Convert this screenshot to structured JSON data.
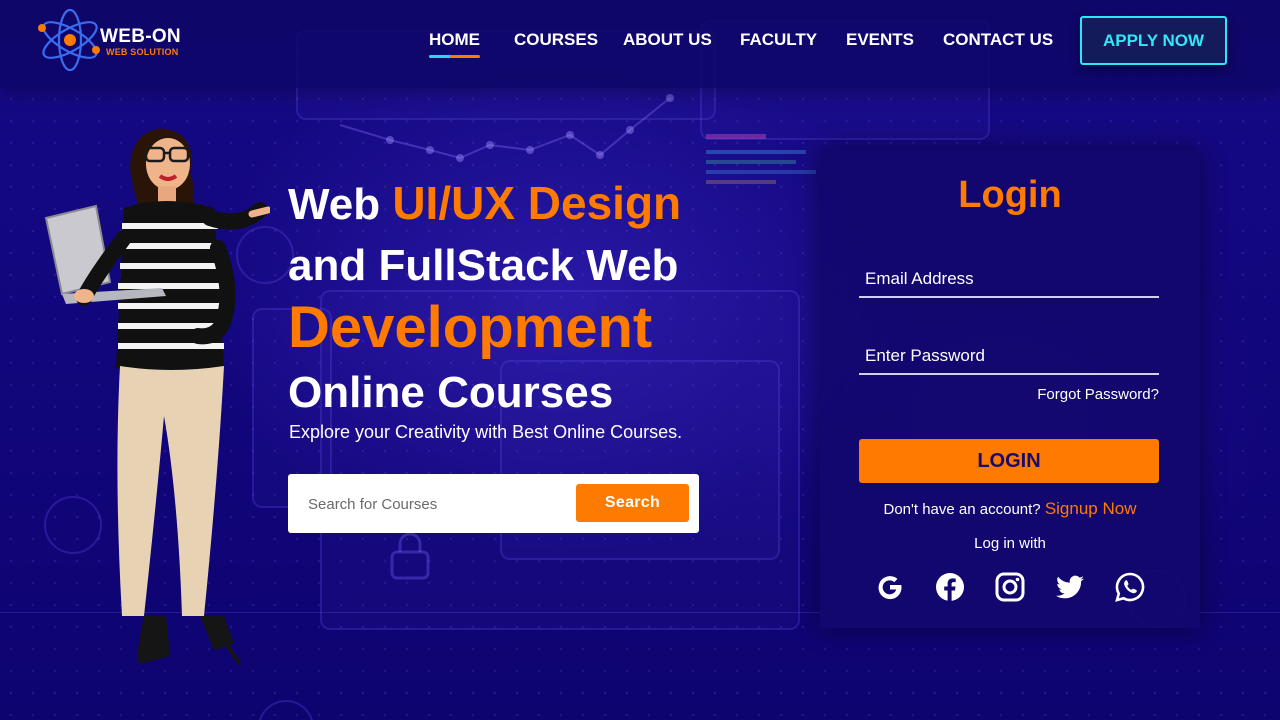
{
  "logo": {
    "name": "WEB-ON",
    "subtitle": "WEB SOLUTION",
    "icon": "atom-icon"
  },
  "nav": {
    "items": [
      {
        "label": "HOME",
        "active": true
      },
      {
        "label": "COURSES",
        "active": false
      },
      {
        "label": "ABOUT US",
        "active": false
      },
      {
        "label": "FACULTY",
        "active": false
      },
      {
        "label": "EVENTS",
        "active": false
      },
      {
        "label": "CONTACT US",
        "active": false
      }
    ],
    "apply_label": "APPLY NOW"
  },
  "hero": {
    "line1_a": "Web ",
    "line1_b": "UI/UX Design",
    "line2": "and FullStack Web",
    "line3": "Development",
    "line4": "Online Courses",
    "tagline": "Explore your Creativity with Best Online Courses."
  },
  "search": {
    "placeholder": "Search for Courses",
    "button_label": "Search"
  },
  "login": {
    "title": "Login",
    "email_placeholder": "Email Address",
    "password_placeholder": "Enter Password",
    "forgot": "Forgot Password?",
    "button_label": "LOGIN",
    "no_account": "Don't have an account? ",
    "signup": "Signup Now",
    "login_with": "Log in with",
    "socials": [
      "google-icon",
      "facebook-icon",
      "instagram-icon",
      "twitter-icon",
      "whatsapp-icon"
    ]
  },
  "colors": {
    "background": "#12067a",
    "accent": "#ff7a00",
    "cyan": "#2ee6f5",
    "panel": "#12086e"
  }
}
